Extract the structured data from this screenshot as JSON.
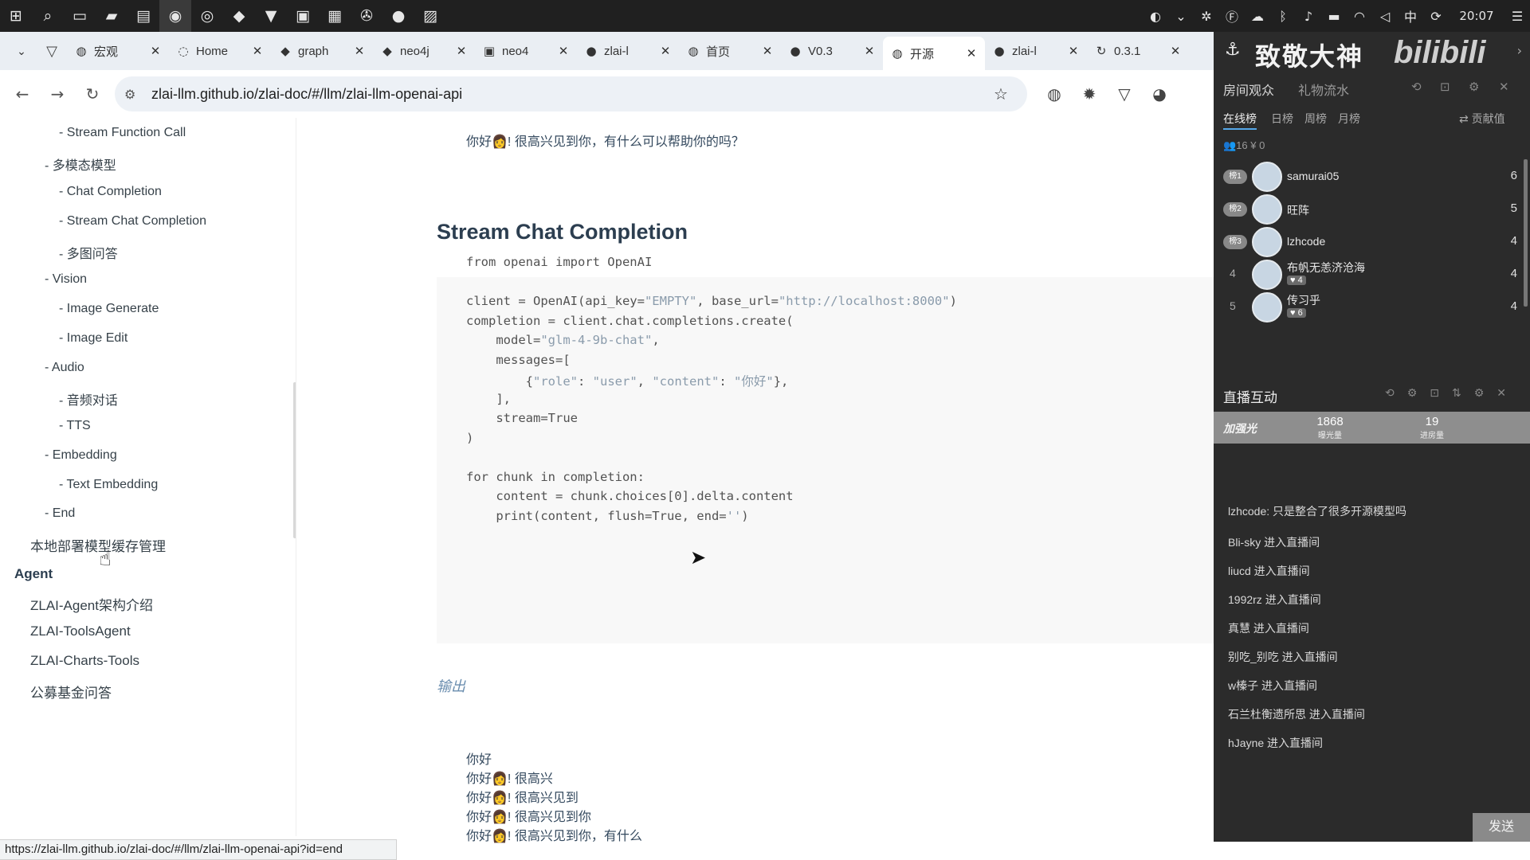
{
  "taskbar": {
    "left_icons": [
      "windows-icon",
      "search-icon",
      "task-view-icon",
      "file-explorer-icon",
      "terminal-icon",
      "obs-icon",
      "wechat-icon",
      "app-icon",
      "vivaldi-icon",
      "pycharm-icon",
      "app-icon-2",
      "steam-icon",
      "app-icon-3",
      "photos-icon"
    ],
    "time": "20:07",
    "ime": "中"
  },
  "tabs": [
    {
      "title": "宏观",
      "icon": "globe"
    },
    {
      "title": "Home",
      "icon": "loader"
    },
    {
      "title": "graph",
      "icon": "tag"
    },
    {
      "title": "neo4j",
      "icon": "tag"
    },
    {
      "title": "neo4",
      "icon": "terminal"
    },
    {
      "title": "zlai-l",
      "icon": "github"
    },
    {
      "title": "首页",
      "icon": "globe"
    },
    {
      "title": "V0.3",
      "icon": "github"
    },
    {
      "title": "开源",
      "icon": "globe",
      "active": true
    },
    {
      "title": "zlai-l",
      "icon": "github"
    },
    {
      "title": "0.3.1",
      "icon": "reload"
    }
  ],
  "address": {
    "url": "zlai-llm.github.io/zlai-doc/#/llm/zlai-llm-openai-api"
  },
  "sidebar": {
    "items": [
      {
        "level": "l3",
        "label": "- Stream Function Call"
      },
      {
        "level": "l2",
        "label": "- 多模态模型"
      },
      {
        "level": "l3",
        "label": "- Chat Completion"
      },
      {
        "level": "l3",
        "label": "- Stream Chat Completion"
      },
      {
        "level": "l3",
        "label": "- 多图问答"
      },
      {
        "level": "l2",
        "label": "- Vision"
      },
      {
        "level": "l3",
        "label": "- Image Generate"
      },
      {
        "level": "l3",
        "label": "- Image Edit"
      },
      {
        "level": "l2",
        "label": "- Audio"
      },
      {
        "level": "l3",
        "label": "- 音频对话"
      },
      {
        "level": "l3",
        "label": "- TTS"
      },
      {
        "level": "l2",
        "label": "- Embedding"
      },
      {
        "level": "l3",
        "label": "- Text Embedding"
      },
      {
        "level": "l2",
        "label": "- End"
      },
      {
        "level": "l1",
        "label": "本地部署模型缓存管理"
      },
      {
        "level": "sec",
        "label": "Agent"
      },
      {
        "level": "l1",
        "label": "ZLAI-Agent架构介绍"
      },
      {
        "level": "l1",
        "label": "ZLAI-ToolsAgent"
      },
      {
        "level": "l1",
        "label": "ZLAI-Charts-Tools"
      },
      {
        "level": "l1",
        "label": "公募基金问答"
      }
    ]
  },
  "main": {
    "top_line": "你好👩! 很高兴见到你，有什么可以帮助你的吗？",
    "heading": "Stream Chat Completion",
    "code_lines": [
      "from openai import OpenAI",
      "",
      "client = OpenAI(api_key=\"EMPTY\", base_url=\"http://localhost:8000\")",
      "completion = client.chat.completions.create(",
      "    model=\"glm-4-9b-chat\",",
      "    messages=[",
      "        {\"role\": \"user\", \"content\": \"你好\"},",
      "    ],",
      "    stream=True",
      ")",
      "",
      "for chunk in completion:",
      "    content = chunk.choices[0].delta.content",
      "    print(content, flush=True, end='')"
    ],
    "output_label": "输出",
    "output_lines": [
      "你好",
      "你好👩! 很高兴",
      "你好👩! 很高兴见到",
      "你好👩! 很高兴见到你",
      "你好👩! 很高兴见到你，有什么"
    ]
  },
  "status_url": "https://zlai-llm.github.io/zlai-doc/#/llm/zlai-llm-openai-api?id=end",
  "live": {
    "banner_title": "致敬大神",
    "banner_logo": "bilibili",
    "tabs": [
      "房间观众",
      "礼物流水"
    ],
    "rank_tabs": [
      "在线榜",
      "日榜",
      "周榜",
      "月榜"
    ],
    "rank_right": "⇄ 贡献值",
    "counts": "👥16  ¥ 0",
    "audience": [
      {
        "rank": "榜1",
        "name": "samurai05",
        "tag": "",
        "score": "6"
      },
      {
        "rank": "榜2",
        "name": "旺阵",
        "tag": "",
        "score": "5"
      },
      {
        "rank": "榜3",
        "name": "lzhcode",
        "tag": "",
        "score": "4"
      },
      {
        "rank": "4",
        "name": "布帆无恙济沧海",
        "tag": "♥ 4",
        "score": "4"
      },
      {
        "rank": "5",
        "name": "传习乎",
        "tag": "♥ 6",
        "score": "4"
      }
    ],
    "interact_title": "直播互动",
    "stat_label": "加强光",
    "stats": [
      {
        "value": "1868",
        "label": "曝光量"
      },
      {
        "value": "19",
        "label": "进房量"
      }
    ],
    "messages": [
      "lzhcode: 只是整合了很多开源模型吗",
      "Bli-sky 进入直播间",
      "liucd 进入直播间",
      "1992rz 进入直播间",
      "真慧 进入直播间",
      "别吃_别吃 进入直播间",
      "w榛子 进入直播间",
      "石兰杜衡遗所思 进入直播间",
      "hJayne 进入直播间"
    ],
    "send_label": "发送"
  }
}
